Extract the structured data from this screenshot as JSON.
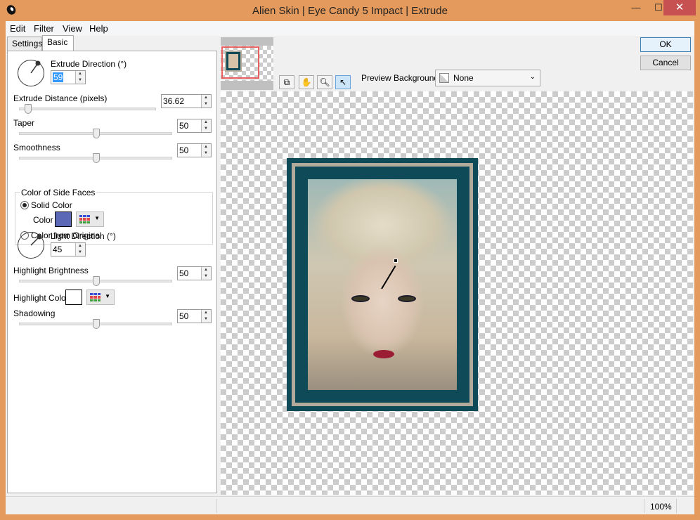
{
  "window": {
    "title": "Alien Skin | Eye Candy 5 Impact | Extrude",
    "minimize": "—",
    "maximize": "☐",
    "close": "✕"
  },
  "menu": [
    "Edit",
    "Filter",
    "View",
    "Help"
  ],
  "tabs": [
    {
      "label": "Settings",
      "active": false
    },
    {
      "label": "Basic",
      "active": true
    }
  ],
  "basic": {
    "extrude_direction": {
      "label": "Extrude Direction (°)",
      "value": "59"
    },
    "extrude_distance": {
      "label": "Extrude Distance (pixels)",
      "value": "36.62",
      "fraction": 0.05
    },
    "taper": {
      "label": "Taper",
      "value": "50",
      "fraction": 0.5
    },
    "smoothness": {
      "label": "Smoothness",
      "value": "50",
      "fraction": 0.5
    },
    "side_faces": {
      "group_label": "Color of Side Faces",
      "solid_color_label": "Solid Color",
      "color_label": "Color",
      "color": "#5b68b5",
      "from_original_label": "Color from Original",
      "selected": "solid"
    },
    "light_direction": {
      "label": "Light Direction (°)",
      "value": "45"
    },
    "highlight_brightness": {
      "label": "Highlight Brightness",
      "value": "50",
      "fraction": 0.5
    },
    "highlight_color": {
      "label": "Highlight Color",
      "color": "#ffffff"
    },
    "shadowing": {
      "label": "Shadowing",
      "value": "50",
      "fraction": 0.5
    }
  },
  "buttons": {
    "ok": "OK",
    "cancel": "Cancel"
  },
  "toolbar": {
    "preview_background_label": "Preview Background:",
    "preview_background_value": "None",
    "tools": [
      "preview-compare-icon",
      "hand-icon",
      "zoom-icon",
      "pointer-icon"
    ]
  },
  "status": {
    "zoom": "100%"
  }
}
